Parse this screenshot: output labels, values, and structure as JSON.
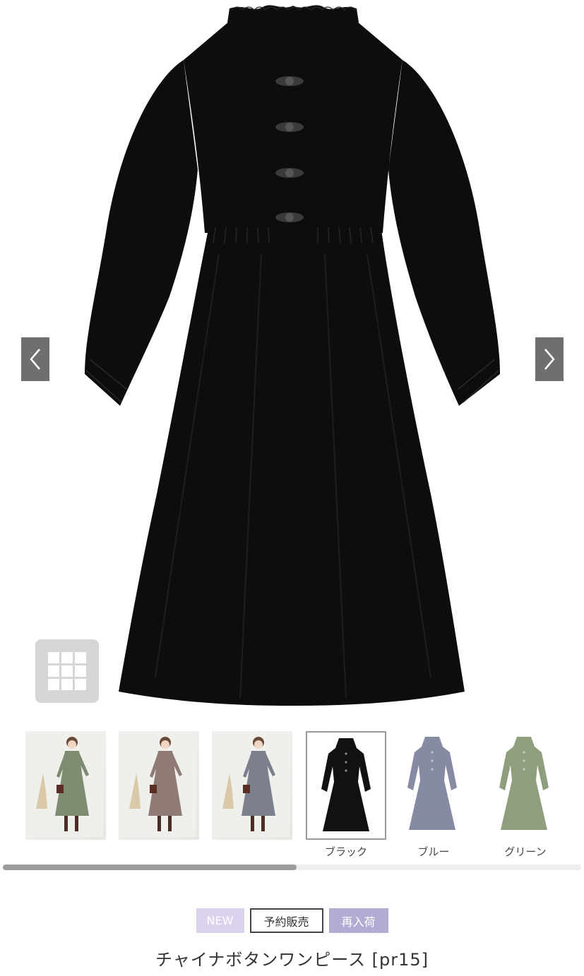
{
  "gallery": {
    "prev_label": "previous-image",
    "next_label": "next-image",
    "grid_button": "grid-icon"
  },
  "thumbnails": [
    {
      "kind": "model",
      "color_hex": "#7d8c71"
    },
    {
      "kind": "model",
      "color_hex": "#8f7a76"
    },
    {
      "kind": "model",
      "color_hex": "#7c7f8d"
    },
    {
      "kind": "product",
      "color_hex": "#111111",
      "label": "ブラック",
      "selected": true
    },
    {
      "kind": "product",
      "color_hex": "#878aa3",
      "label": "ブルー"
    },
    {
      "kind": "product",
      "color_hex": "#8f9f7e",
      "label": "グリーン"
    }
  ],
  "scroll": {
    "position_fraction": 0.0,
    "visible_fraction": 0.51
  },
  "badges": {
    "new": "NEW",
    "preorder": "予約販売",
    "restock": "再入荷"
  },
  "product": {
    "title": "チャイナボタンワンピース [pr15]"
  },
  "colors": {
    "dress_main": "#0d0d0d",
    "arrow_bg": "#6f6f6f",
    "badge_new": "#ddd2ee",
    "badge_restock": "#b3abd3"
  }
}
